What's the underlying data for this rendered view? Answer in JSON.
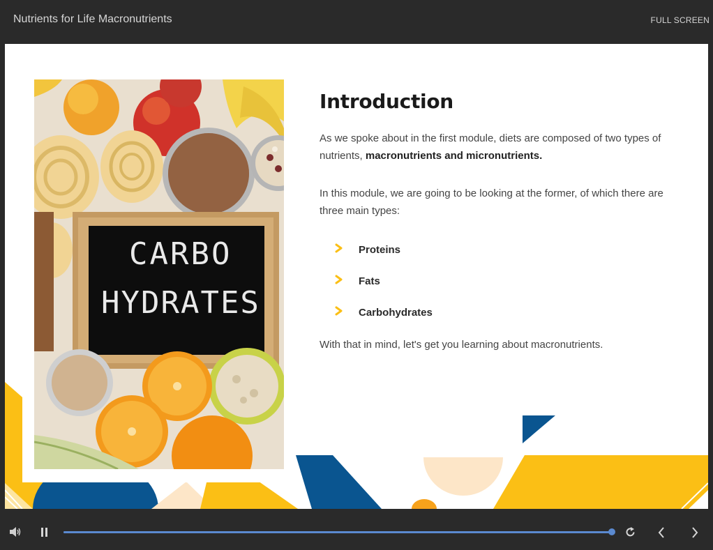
{
  "header": {
    "course_title": "Nutrients for Life Macronutrients",
    "fullscreen_label": "FULL SCREEN"
  },
  "slide": {
    "image": {
      "chalk_line1": "CARBO",
      "chalk_line2": "HYDRATES",
      "description": "Chalkboard sign surrounded by fruits, grains and pasta"
    },
    "heading": "Introduction",
    "para1_text": "As we spoke about in the first module, diets are composed of two types of nutrients, ",
    "para1_bold": "macronutrients and micronutrients.",
    "para2": "In this module, we are going to be looking at the former, of which there are three main types:",
    "bullets": [
      {
        "label": "Proteins"
      },
      {
        "label": "Fats"
      },
      {
        "label": "Carbohydrates"
      }
    ],
    "para3": "With that in mind, let's get you learning about macronutrients."
  },
  "player": {
    "progress": 1.0,
    "icons": {
      "volume": "volume-icon",
      "pause": "pause-icon",
      "replay": "replay-icon",
      "prev": "chevron-left-icon",
      "next": "chevron-right-icon"
    }
  },
  "colors": {
    "accent_yellow": "#fbbf15",
    "accent_blue": "#0a5590",
    "accent_peach": "#fde6c8",
    "progress": "#5b8ad0",
    "chrome": "#2a2a2a"
  }
}
